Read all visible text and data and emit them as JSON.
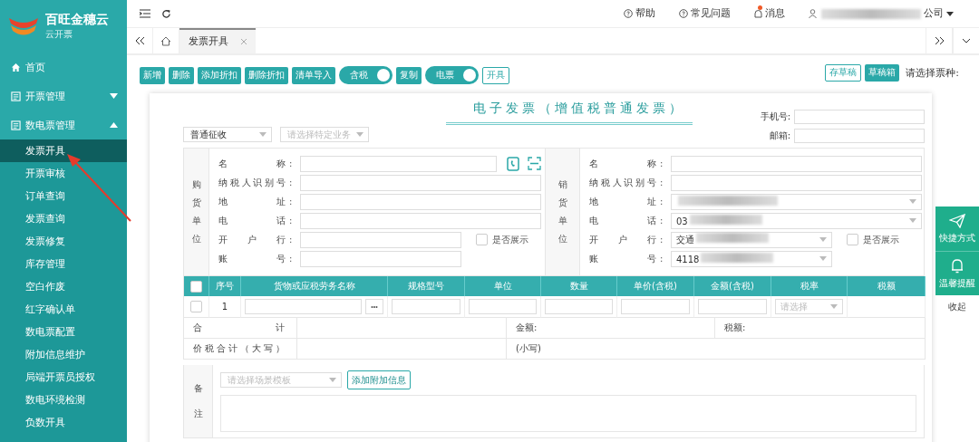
{
  "brand": {
    "name": "百旺金穗云",
    "subtitle": "云开票"
  },
  "sidebar": {
    "items": [
      {
        "label": "首页",
        "kind": "home"
      },
      {
        "label": "开票管理",
        "kind": "group",
        "expanded": false
      },
      {
        "label": "数电票管理",
        "kind": "group",
        "expanded": true,
        "children": [
          {
            "label": "发票开具",
            "selected": true
          },
          {
            "label": "开票审核",
            "selected": false
          },
          {
            "label": "订单查询",
            "selected": false
          },
          {
            "label": "发票查询",
            "selected": false
          },
          {
            "label": "发票修复",
            "selected": false
          },
          {
            "label": "库存管理",
            "selected": false
          },
          {
            "label": "空白作废",
            "selected": false
          },
          {
            "label": "红字确认单",
            "selected": false
          },
          {
            "label": "数电票配置",
            "selected": false
          },
          {
            "label": "附加信息维护",
            "selected": false
          },
          {
            "label": "局端开票员授权",
            "selected": false
          },
          {
            "label": "数电环境检测",
            "selected": false
          },
          {
            "label": "负数开具",
            "selected": false
          }
        ]
      }
    ]
  },
  "topbar": {
    "links": [
      "帮助",
      "常见问题"
    ],
    "messages": {
      "label": "消息",
      "unread": true
    },
    "user": "公司"
  },
  "tabs": [
    {
      "label": "发票开具",
      "selected": true
    }
  ],
  "toolbar": [
    {
      "label": "新增",
      "kind": "button"
    },
    {
      "label": "删除",
      "kind": "button"
    },
    {
      "label": "添加折扣",
      "kind": "button"
    },
    {
      "label": "删除折扣",
      "kind": "button"
    },
    {
      "label": "清单导入",
      "kind": "button"
    },
    {
      "label": "含税",
      "kind": "toggle",
      "on": true
    },
    {
      "label": "复制",
      "kind": "button"
    },
    {
      "label": "电票",
      "kind": "toggle",
      "on": true
    },
    {
      "label": "开具",
      "kind": "outline"
    }
  ],
  "toolbar_right": [
    {
      "label": "存草稿",
      "kind": "outline"
    },
    {
      "label": "草稿箱",
      "kind": "button"
    }
  ],
  "invoice_type_prompt": "请选择票种:",
  "invoice": {
    "title": "电子发票（增值税普通发票）",
    "levy_select": {
      "value": "普通征收"
    },
    "business_select": {
      "placeholder": "请选择特定业务"
    },
    "contacts": [
      {
        "label": "手机号:"
      },
      {
        "label": "邮箱:"
      }
    ],
    "colon": ":",
    "buyer": {
      "side_label": "购货单位",
      "fields": [
        {
          "label": "名称",
          "kind": "name"
        },
        {
          "label": "纳税人识别号",
          "kind": "text"
        },
        {
          "label": "地址",
          "kind": "text"
        },
        {
          "label": "电话",
          "kind": "text"
        },
        {
          "label": "开户行",
          "kind": "short"
        },
        {
          "label": "账号",
          "kind": "short"
        }
      ],
      "show_option": {
        "label": "是否展示",
        "checked": false
      }
    },
    "seller": {
      "side_label": "销货单位",
      "fields": [
        {
          "label": "名称",
          "kind": "text"
        },
        {
          "label": "纳税人识别号",
          "kind": "text"
        },
        {
          "label": "地址",
          "kind": "select",
          "redacted": true
        },
        {
          "label": "电话",
          "kind": "select",
          "value": "03",
          "redacted": true
        },
        {
          "label": "开户行",
          "kind": "short-select",
          "value": "交通",
          "redacted": true
        },
        {
          "label": "账号",
          "kind": "short-select",
          "value": "4118",
          "redacted": true
        }
      ],
      "show_option": {
        "label": "是否展示",
        "checked": false
      }
    },
    "table": {
      "header_checked": false,
      "columns": [
        "序号",
        "货物或应税劳务名称",
        "规格型号",
        "单位",
        "数量",
        "单价(含税)",
        "金额(含税)",
        "税率",
        "税额"
      ],
      "rows": [
        {
          "checked": false,
          "index": "1",
          "more": "•••",
          "tax_rate_placeholder": "请选择"
        }
      ]
    },
    "totals": {
      "label": "合计",
      "amount_label": "金额:",
      "tax_label": "税额:",
      "grand_label": "价税合计（大写）",
      "small_label": "(小写)"
    },
    "remarks": {
      "side_label": "备注",
      "template_placeholder": "请选择场景模板",
      "add_button": "添加附加信息"
    }
  },
  "float_panel": {
    "items": [
      {
        "label": "快捷方式",
        "kind": "send"
      },
      {
        "label": "温馨提醒",
        "kind": "bell"
      }
    ],
    "collapse": "收起"
  }
}
